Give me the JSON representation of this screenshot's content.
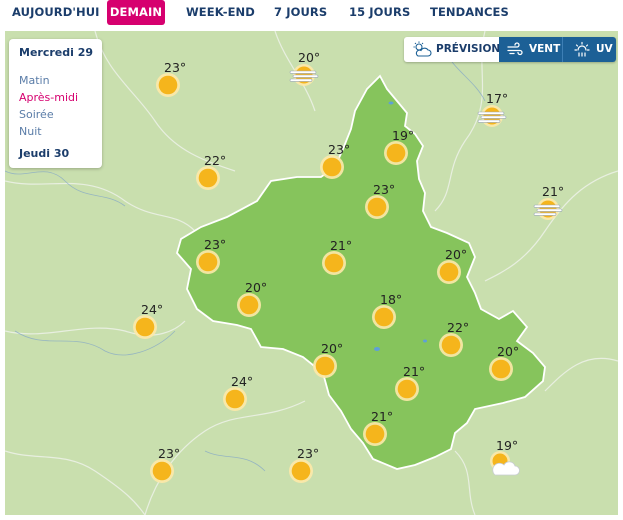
{
  "nav": {
    "tabs": [
      {
        "id": "today",
        "label": "AUJOURD'HUI"
      },
      {
        "id": "tomorrow",
        "label": "DEMAIN",
        "active": true
      },
      {
        "id": "weekend",
        "label": "WEEK-END"
      },
      {
        "id": "7days",
        "label": "7 JOURS"
      },
      {
        "id": "15days",
        "label": "15 JOURS"
      },
      {
        "id": "trends",
        "label": "TENDANCES"
      }
    ]
  },
  "periods": {
    "day1": "Mercredi 29",
    "items": [
      {
        "label": "Matin"
      },
      {
        "label": "Après-midi",
        "active": true
      },
      {
        "label": "Soirée"
      },
      {
        "label": "Nuit"
      }
    ],
    "day2": "Jeudi 30"
  },
  "modes": {
    "forecast_label": "PRÉVISIONS",
    "wind_label": "VENT",
    "uv_label": "UV"
  },
  "colors": {
    "accent": "#d6006f",
    "navy": "#1b3d6b",
    "mode_blue": "#1c6096",
    "region_fill": "#86c45c",
    "outer_land": "#c9dfae",
    "sun": "#f5b51c"
  },
  "markers": [
    {
      "temp": "23°",
      "icon": "sun-icon"
    },
    {
      "temp": "20°",
      "icon": "fog-icon"
    },
    {
      "temp": "17°",
      "icon": "fog-icon"
    },
    {
      "temp": "19°",
      "icon": "sun-icon"
    },
    {
      "temp": "23°",
      "icon": "sun-icon"
    },
    {
      "temp": "22°",
      "icon": "sun-icon"
    },
    {
      "temp": "23°",
      "icon": "sun-icon"
    },
    {
      "temp": "21°",
      "icon": "fog-icon"
    },
    {
      "temp": "23°",
      "icon": "sun-icon"
    },
    {
      "temp": "21°",
      "icon": "sun-icon"
    },
    {
      "temp": "20°",
      "icon": "sun-icon"
    },
    {
      "temp": "20°",
      "icon": "sun-icon"
    },
    {
      "temp": "24°",
      "icon": "sun-icon"
    },
    {
      "temp": "18°",
      "icon": "sun-icon"
    },
    {
      "temp": "22°",
      "icon": "sun-icon"
    },
    {
      "temp": "20°",
      "icon": "sun-icon"
    },
    {
      "temp": "20°",
      "icon": "sun-icon"
    },
    {
      "temp": "21°",
      "icon": "sun-icon"
    },
    {
      "temp": "24°",
      "icon": "sun-icon"
    },
    {
      "temp": "21°",
      "icon": "sun-icon"
    },
    {
      "temp": "19°",
      "icon": "sun-cloud-icon"
    },
    {
      "temp": "23°",
      "icon": "sun-icon"
    },
    {
      "temp": "23°",
      "icon": "sun-icon"
    }
  ]
}
